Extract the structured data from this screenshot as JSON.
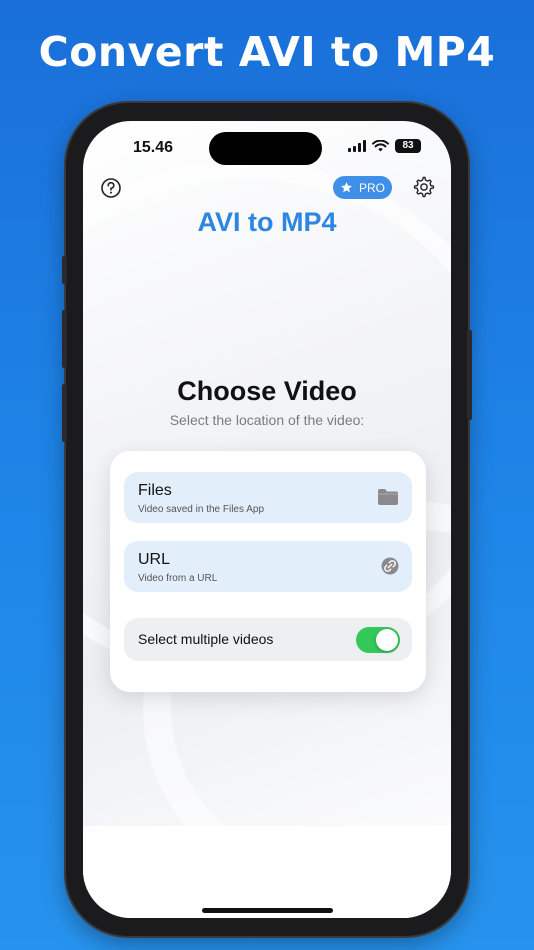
{
  "promo": {
    "headline": "Convert AVI to MP4"
  },
  "status_bar": {
    "time": "15.46",
    "battery": "83"
  },
  "header": {
    "pro_label": "PRO",
    "app_title": "AVI to MP4"
  },
  "main": {
    "title": "Choose Video",
    "subtitle": "Select the location of the video:",
    "options": [
      {
        "title": "Files",
        "subtitle": "Video saved in the Files App",
        "icon": "folder-icon"
      },
      {
        "title": "URL",
        "subtitle": "Video from a URL",
        "icon": "link-icon"
      }
    ],
    "multi_select": {
      "label": "Select multiple videos",
      "enabled": true
    }
  },
  "colors": {
    "accent": "#2f86e0",
    "pro_badge": "#3f8ee8",
    "toggle_on": "#34c759",
    "option_bg": "#e3eefb"
  }
}
